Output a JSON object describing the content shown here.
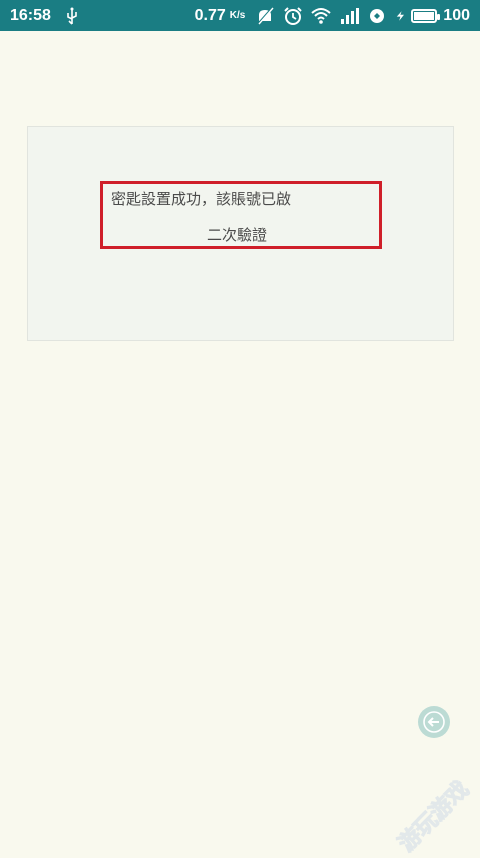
{
  "status_bar": {
    "time": "16:58",
    "net_speed": "0.77",
    "net_speed_unit": "K/s",
    "battery_level": "100",
    "icons": [
      "usb-icon",
      "mute-icon",
      "alarm-icon",
      "wifi-icon",
      "signal-icon",
      "data-saver-icon",
      "charging-icon",
      "battery-icon"
    ],
    "color": "#1a7d83"
  },
  "message": {
    "line1": "密匙設置成功，該賬號已啟",
    "line2": "二次驗證",
    "highlight_color": "#cf1f29"
  },
  "back_button": {
    "icon": "arrow-left-icon"
  },
  "watermark": {
    "text": "游玩游戏"
  }
}
